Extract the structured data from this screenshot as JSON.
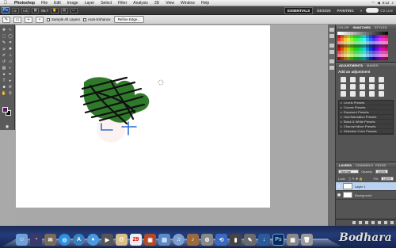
{
  "menubar": {
    "app": "Photoshop",
    "items": [
      "File",
      "Edit",
      "Image",
      "Layer",
      "Select",
      "Filter",
      "Analysis",
      "3D",
      "View",
      "Window",
      "Help"
    ],
    "time": "5:12"
  },
  "appbar": {
    "logo": "Ps",
    "zoom": "66.7",
    "workspaces": [
      "ESSENTIALS",
      "DESIGN",
      "PAINTING",
      "»"
    ],
    "cslive": "CS Live"
  },
  "options": {
    "sample_all_layers": "Sample All Layers",
    "auto_enhance": "Auto-Enhance",
    "refine_edge": "Refine Edge..."
  },
  "swatches_panel": {
    "tabs": [
      "COLOR",
      "SWATCHES",
      "STYLES"
    ],
    "active_tab": "SWATCHES"
  },
  "adjustments_panel": {
    "tabs": [
      "ADJUSTMENTS",
      "MASKS"
    ],
    "title": "Add an adjustment",
    "presets": [
      "Levels Presets",
      "Curves Presets",
      "Exposure Presets",
      "Hue/Saturation Presets",
      "Black & White Presets",
      "Channel Mixer Presets",
      "Selective Color Presets"
    ]
  },
  "layers_panel": {
    "tabs": [
      "LAYERS",
      "CHANNELS",
      "PATHS"
    ],
    "blend_mode": "Normal",
    "opacity_label": "Opacity:",
    "opacity": "100%",
    "lock_label": "Lock:",
    "fill_label": "Fill:",
    "fill": "100%",
    "layers": [
      {
        "name": "Layer 1",
        "selected": true
      },
      {
        "name": "Background",
        "selected": false
      }
    ]
  },
  "foreground_color": "#5a1a5e",
  "background_color": "#111111",
  "watermark": "Bodhara"
}
